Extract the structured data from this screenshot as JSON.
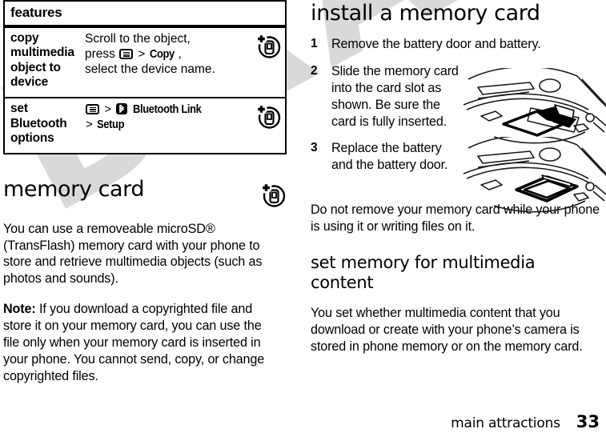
{
  "document": {
    "watermark_text": "DRAFT",
    "watermark_color": "#d9d9d9"
  },
  "features_table": {
    "header": "features",
    "rows": [
      {
        "term": "copy multimedia object to device",
        "desc_line1_pre": "Scroll to the object,",
        "desc_line2_pre": "press",
        "desc_line2_menu_icon": "menu-key-icon",
        "desc_line2_gt": ">",
        "desc_line2_option": "Copy",
        "desc_line2_post": ",",
        "desc_line3": "select the device name.",
        "row_icon": "phone-plus-icon"
      },
      {
        "term": "set Bluetooth options",
        "desc_line1_menu_icon": "menu-key-icon",
        "desc_line1_gt": ">",
        "desc_line1_bt_icon": "bluetooth-icon",
        "desc_line1_option": "Bluetooth Link",
        "desc_line2_gt": ">",
        "desc_line2_option": "Setup",
        "row_icon": "phone-plus-icon"
      }
    ]
  },
  "memory_card_section": {
    "heading": "memory card",
    "heading_icon": "phone-plus-icon",
    "paragraph_1": "You can use a removeable microSD® (TransFlash) memory card with your phone to store and retrieve multimedia objects (such as photos and sounds).",
    "note_label": "Note:",
    "note_text": " If you download a copyrighted file and store it on your memory card, you can use the file only when your memory card is inserted in your phone. You cannot send, copy, or change copyrighted files."
  },
  "install_section": {
    "heading": "install a memory card",
    "steps": [
      {
        "number": "1",
        "text": "Remove the battery door and battery."
      },
      {
        "number": "2",
        "text": "Slide the memory card into the card slot as shown. Be sure the card is fully inserted.",
        "figure": "phone-card-slot-insert-diagram"
      },
      {
        "number": "3",
        "text": "Replace the battery and the battery door.",
        "figure": "phone-card-slot-seated-diagram"
      }
    ],
    "warning": "Do not remove your memory card while your phone is using it or writing files on it."
  },
  "set_memory_section": {
    "heading": "set memory for multimedia content",
    "paragraph": "You set whether multimedia content that you download or create with your phone’s camera is stored in phone memory or on the memory card."
  },
  "footer": {
    "label": "main attractions",
    "page_number": "33"
  }
}
